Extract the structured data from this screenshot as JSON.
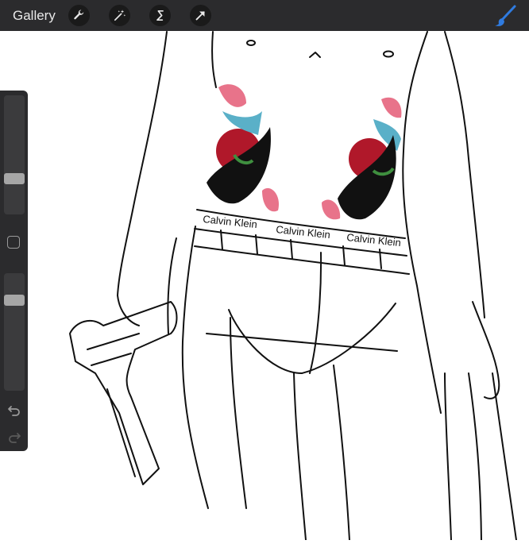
{
  "topbar": {
    "gallery_label": "Gallery",
    "tools": [
      "wrench-icon",
      "magic-wand-icon",
      "selection-s-icon",
      "transform-arrow-icon"
    ],
    "active_brush_color": "#2f7be0"
  },
  "sidebar": {
    "brush_size_level": 0.72,
    "opacity_level": 0.2,
    "undo_icon": "undo-icon",
    "redo_icon": "redo-icon"
  },
  "canvas": {
    "waistband_brand_text": [
      "Calvin Klein",
      "Calvin Klein",
      "Calvin Klein"
    ],
    "tattoo_colors": [
      "#e8738a",
      "#b0182a",
      "#5ab0c8",
      "#3f8f3f",
      "#111111"
    ]
  }
}
